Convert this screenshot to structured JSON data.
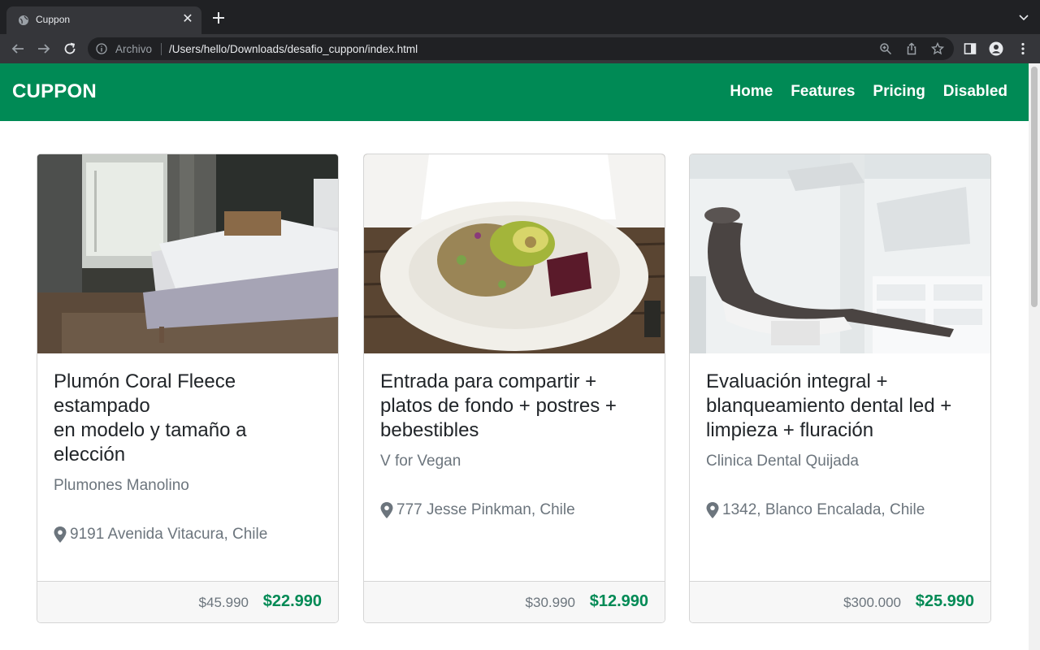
{
  "browser": {
    "tab_title": "Cuppon",
    "url_scheme": "Archivo",
    "url": "/Users/hello/Downloads/desafio_cuppon/index.html"
  },
  "navbar": {
    "brand": "CUPPON",
    "links": [
      "Home",
      "Features",
      "Pricing",
      "Disabled"
    ],
    "color": "#008a55"
  },
  "cards": [
    {
      "title_lines": [
        "Plumón Coral Fleece",
        "estampado",
        "en modelo y tamaño a",
        "elección"
      ],
      "merchant": "Plumones Manolino",
      "location": "9191 Avenida Vitacura, Chile",
      "old_price": "$45.990",
      "new_price": "$22.990",
      "image": "bedroom"
    },
    {
      "title_lines": [
        "Entrada para compartir +",
        "platos de fondo + postres +",
        "bebestibles"
      ],
      "merchant": "V for Vegan",
      "location": "777 Jesse Pinkman, Chile",
      "old_price": "$30.990",
      "new_price": "$12.990",
      "image": "salad-plate"
    },
    {
      "title_lines": [
        "Evaluación integral +",
        "blanqueamiento dental led +",
        "limpieza + fluración"
      ],
      "merchant": "Clinica Dental Quijada",
      "location": "1342, Blanco Encalada, Chile",
      "old_price": "$300.000",
      "new_price": "$25.990",
      "image": "dental-chair"
    }
  ]
}
